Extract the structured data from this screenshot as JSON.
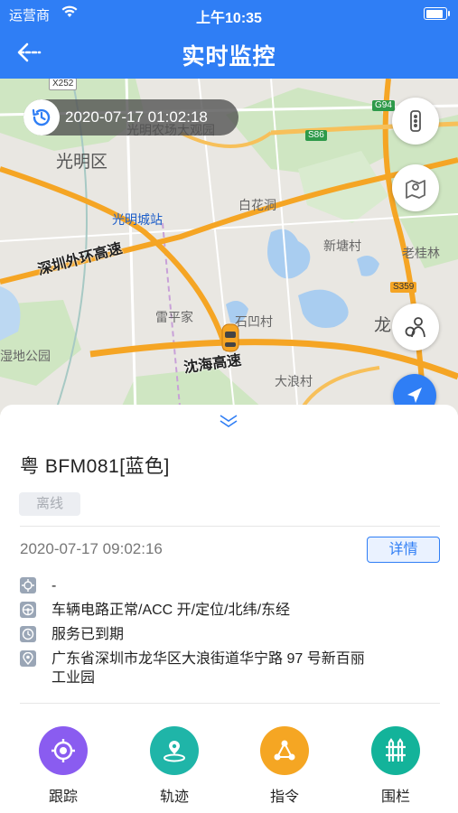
{
  "status_bar": {
    "carrier": "运营商",
    "time": "上午10:35"
  },
  "nav": {
    "title": "实时监控"
  },
  "map": {
    "timestamp": "2020-07-17 01:02:18",
    "labels": {
      "guangming_district": "光明区",
      "guangming_farm": "光明农场大观园",
      "guangming_station": "光明城站",
      "baihuadong": "白花洞",
      "xintangcun": "新塘村",
      "laoguilin": "老桂林",
      "shenzhen_outer_ring": "深圳外环高速",
      "leipingjia": "雷平家",
      "shiaocun": "石凹村",
      "longhua_partial": "龙",
      "wetland_park": "湿地公园",
      "yanhai_expressway": "沈海高速",
      "dalangcun": "大浪村",
      "x252": "X252",
      "g94": "G94",
      "s86": "S86",
      "s359": "S359"
    }
  },
  "vehicle": {
    "plate": "粤 BFM081[蓝色]",
    "status": "离线",
    "datetime": "2020-07-17 09:02:16",
    "detail_label": "详情",
    "info": [
      {
        "icon": "crosshair-icon",
        "text": "-"
      },
      {
        "icon": "steering-wheel-icon",
        "text": "车辆电路正常/ACC 开/定位/北纬/东经"
      },
      {
        "icon": "clock-icon",
        "text": "服务已到期"
      },
      {
        "icon": "location-pin-icon",
        "text": "广东省深圳市龙华区大浪街道华宁路 97 号新百丽",
        "text2": "工业园"
      }
    ]
  },
  "actions": [
    {
      "label": "跟踪",
      "color": "#8a5cf0",
      "icon": "track-target-icon"
    },
    {
      "label": "轨迹",
      "color": "#1fb5a8",
      "icon": "route-pin-icon"
    },
    {
      "label": "指令",
      "color": "#f5a623",
      "icon": "command-share-icon"
    },
    {
      "label": "围栏",
      "color": "#13b39a",
      "icon": "fence-icon"
    }
  ],
  "colors": {
    "primary": "#2f7ef5"
  }
}
